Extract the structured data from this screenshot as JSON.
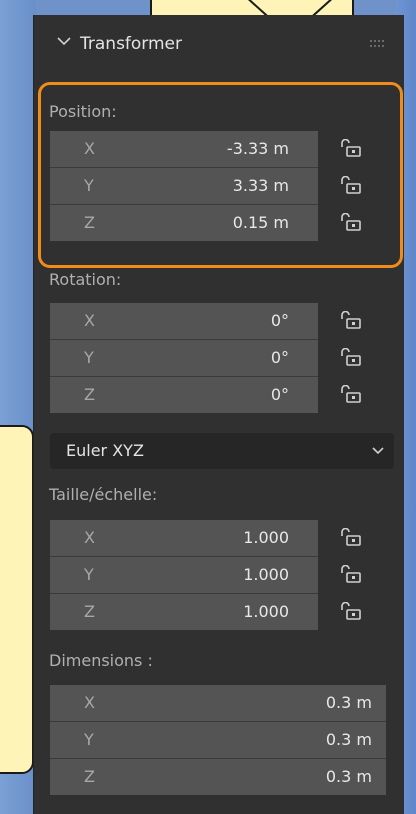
{
  "panel": {
    "title": "Transformer"
  },
  "position": {
    "label": "Position:",
    "fields": [
      {
        "axis": "X",
        "value": "-3.33 m"
      },
      {
        "axis": "Y",
        "value": "3.33 m"
      },
      {
        "axis": "Z",
        "value": "0.15 m"
      }
    ]
  },
  "rotation": {
    "label": "Rotation:",
    "fields": [
      {
        "axis": "X",
        "value": "0°"
      },
      {
        "axis": "Y",
        "value": "0°"
      },
      {
        "axis": "Z",
        "value": "0°"
      }
    ],
    "mode": "Euler XYZ"
  },
  "scale": {
    "label": "Taille/échelle:",
    "fields": [
      {
        "axis": "X",
        "value": "1.000"
      },
      {
        "axis": "Y",
        "value": "1.000"
      },
      {
        "axis": "Z",
        "value": "1.000"
      }
    ]
  },
  "dimensions": {
    "label": "Dimensions :",
    "fields": [
      {
        "axis": "X",
        "value": "0.3 m"
      },
      {
        "axis": "Y",
        "value": "0.3 m"
      },
      {
        "axis": "Z",
        "value": "0.3 m"
      }
    ]
  },
  "colors": {
    "highlight": "#f08c1a",
    "callout_fill": "#fff4b8",
    "panel_bg": "#303030",
    "field_bg": "#545454"
  },
  "icons": {
    "collapse": "chevron-down-icon",
    "drag": "drag-handle-icon",
    "lock": "lock-open-icon",
    "dropdown": "chevron-down-icon"
  }
}
